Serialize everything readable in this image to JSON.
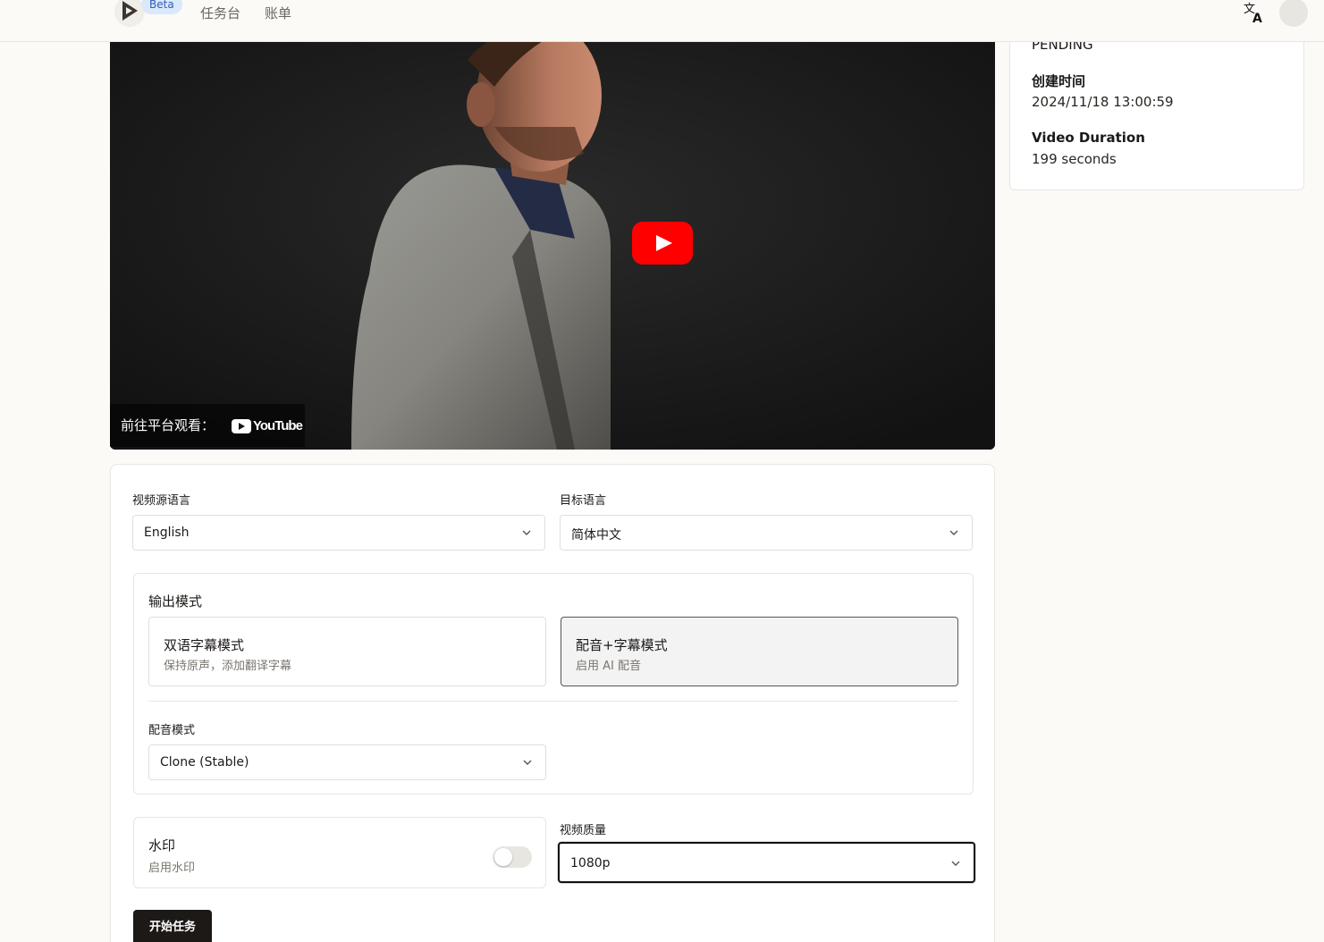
{
  "header": {
    "beta": "Beta",
    "nav": {
      "tasks": "任务台",
      "bills": "账单"
    }
  },
  "video": {
    "watch_on": "前往平台观看：",
    "platform": "YouTube"
  },
  "info": {
    "status": "PENDING",
    "created_label": "创建时间",
    "created_value": "2024/11/18 13:00:59",
    "duration_label": "Video Duration",
    "duration_value": "199 seconds"
  },
  "form": {
    "source_lang_label": "视频源语言",
    "source_lang_value": "English",
    "target_lang_label": "目标语言",
    "target_lang_value": "简体中文",
    "output_mode_title": "输出模式",
    "modes": [
      {
        "title": "双语字幕模式",
        "desc": "保持原声，添加翻译字幕"
      },
      {
        "title": "配音+字幕模式",
        "desc": "启用 AI 配音"
      }
    ],
    "dubbing_label": "配音模式",
    "dubbing_value": "Clone (Stable)",
    "watermark_title": "水印",
    "watermark_desc": "启用水印",
    "watermark_enabled": false,
    "quality_label": "视频质量",
    "quality_value": "1080p",
    "start_button": "开始任务"
  }
}
